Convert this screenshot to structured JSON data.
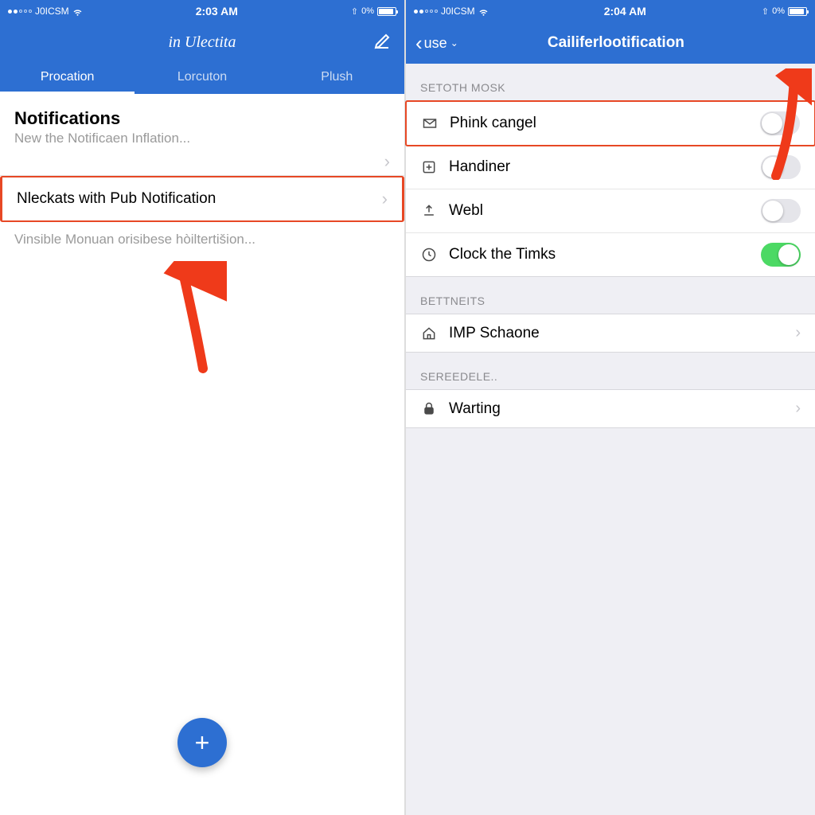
{
  "colors": {
    "primary": "#2d6fd2",
    "highlight": "#e74825",
    "toggle_on": "#4cd964"
  },
  "left": {
    "status": {
      "carrier": "J0ICSM",
      "time": "2:03 AM",
      "battery": "0%"
    },
    "header": {
      "title": "in Ulectita"
    },
    "tabs": {
      "t1": "Procation",
      "t2": "Lorcuton",
      "t3": "Plush"
    },
    "section": {
      "title": "Notifications",
      "sub": "New the Notificaen Inflation..."
    },
    "row_highlight": "Nleckats with Pub Notification",
    "subtext": "Vinsible Monuan orisibese hòiltertišion...",
    "fab_glyph": "+"
  },
  "right": {
    "status": {
      "carrier": "J0ICSM",
      "time": "2:04 AM",
      "battery": "0%"
    },
    "back": "use",
    "title": "Cailiferlootification",
    "group1": {
      "header": "SETOTH MOSK",
      "items": [
        {
          "label": "Phink cangel",
          "toggle": false,
          "highlight": true
        },
        {
          "label": "Handiner",
          "toggle": false
        },
        {
          "label": "Webl",
          "toggle": false
        },
        {
          "label": "Clock the Timks",
          "toggle": true
        }
      ]
    },
    "group2": {
      "header": "BETTNEITS",
      "items": [
        {
          "label": "IMP Schaone"
        }
      ]
    },
    "group3": {
      "header": "SEREEDELE..",
      "items": [
        {
          "label": "Warting"
        }
      ]
    }
  }
}
